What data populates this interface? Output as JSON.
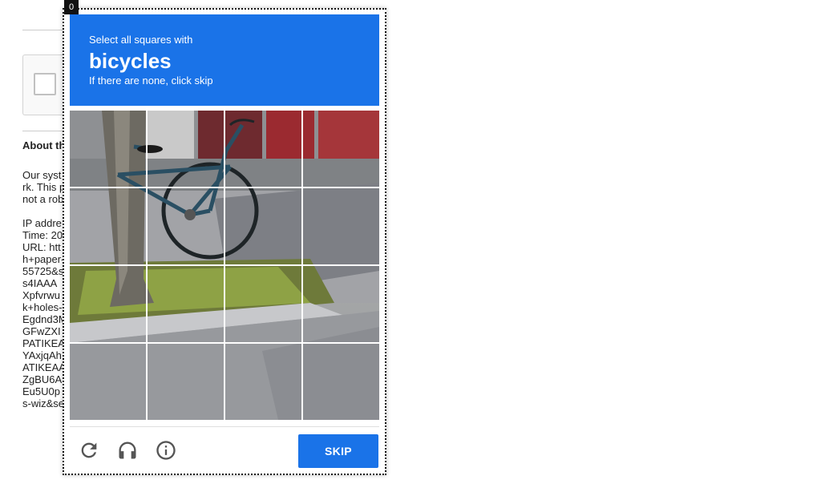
{
  "frame_index": "0",
  "background": {
    "about_heading": "About th",
    "text_lines": [
      "Our syst",
      "rk. This p",
      "not a rob",
      "",
      "IP addre",
      "Time: 20",
      "URL: htt",
      "h+paper-",
      "55725&s",
      "s4IAAA",
      "Xpfvrwu",
      "k+holes-",
      "Egdnd3M",
      "GFwZXI",
      "PATIKEA",
      "YAxjqAh",
      "ATIKEAA",
      "ZgBU6A",
      "Eu5U0p",
      "s-wiz&se"
    ]
  },
  "challenge": {
    "instruction": "Select all squares with",
    "keyword": "bicycles",
    "hint": "If there are none, click skip",
    "grid": {
      "rows": 4,
      "cols": 4
    },
    "tiles": [
      "tile-r1c1",
      "tile-r1c2",
      "tile-r1c3",
      "tile-r1c4",
      "tile-r2c1",
      "tile-r2c2",
      "tile-r2c3",
      "tile-r2c4",
      "tile-r3c1",
      "tile-r3c2",
      "tile-r3c3",
      "tile-r3c4",
      "tile-r4c1",
      "tile-r4c2",
      "tile-r4c3",
      "tile-r4c4"
    ],
    "controls": {
      "reload_icon": "reload-icon",
      "audio_icon": "headphones-icon",
      "info_icon": "info-icon",
      "skip_label": "SKIP"
    },
    "colors": {
      "accent": "#1a73e8",
      "icon": "#555555"
    }
  }
}
